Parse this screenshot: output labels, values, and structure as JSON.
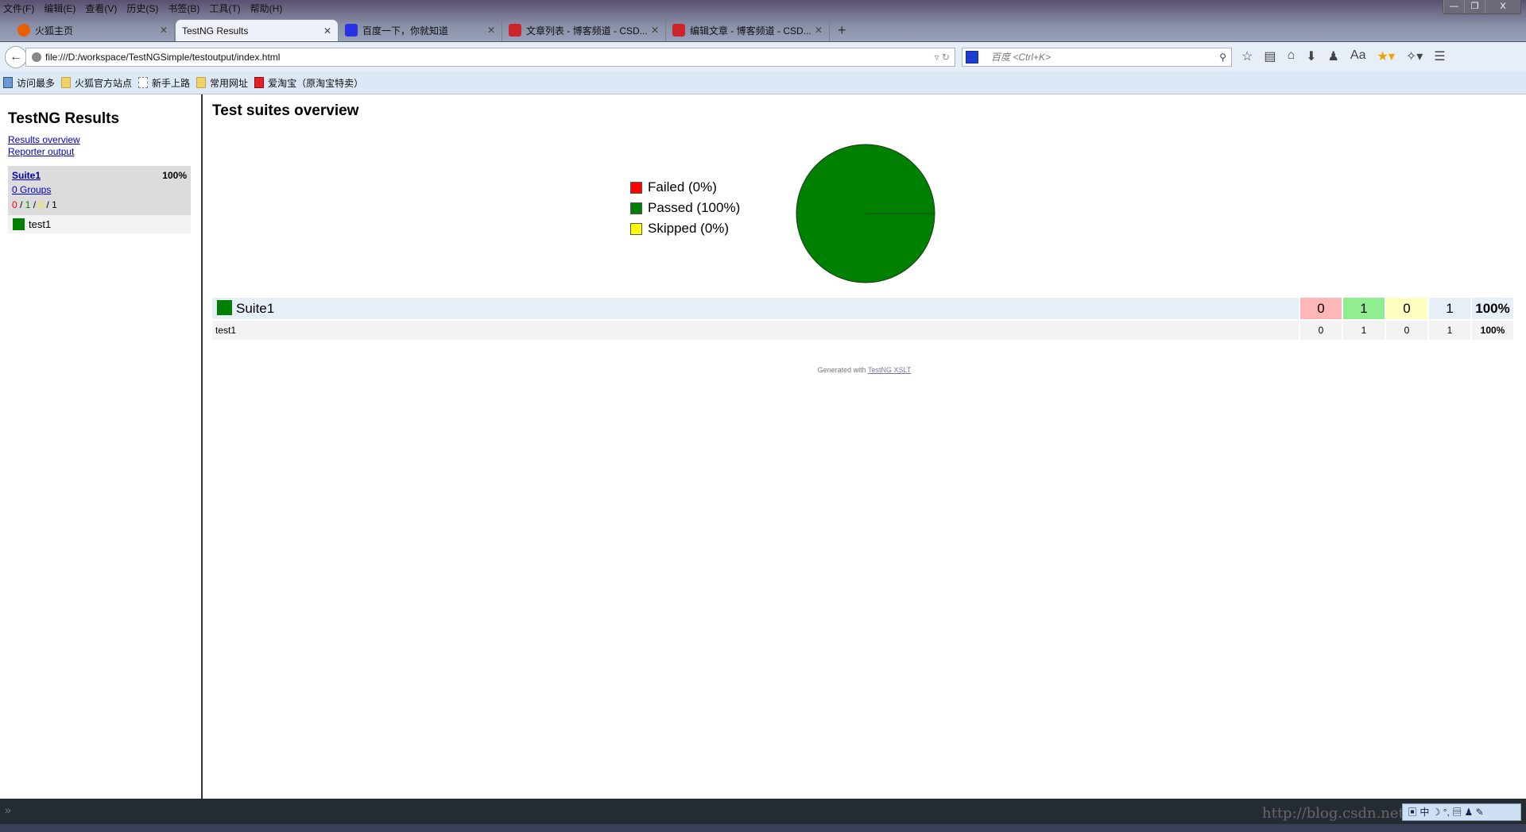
{
  "menubar": [
    "文件(F)",
    "编辑(E)",
    "查看(V)",
    "历史(S)",
    "书签(B)",
    "工具(T)",
    "帮助(H)"
  ],
  "window_buttons": [
    "—",
    "❐",
    "X"
  ],
  "tabs": [
    {
      "label": "火狐主页",
      "color": "#e66000"
    },
    {
      "label": "TestNG Results",
      "active": true
    },
    {
      "label": "百度一下，你就知道",
      "color": "#2932e1"
    },
    {
      "label": "文章列表 - 博客频道 - CSD...",
      "color": "#c9252b"
    },
    {
      "label": "编辑文章 - 博客频道 - CSD...",
      "color": "#c9252b"
    }
  ],
  "nav": {
    "url": "file:///D:/workspace/TestNGSimple/testoutput/index.html",
    "search_placeholder": "百度 <Ctrl+K>"
  },
  "bookmarks": [
    "访问最多",
    "火狐官方站点",
    "新手上路",
    "常用网址",
    "爱淘宝（原淘宝特卖）"
  ],
  "sidebar": {
    "title": "TestNG Results",
    "links": [
      "Results overview",
      "Reporter output"
    ],
    "suite": {
      "name": "Suite1",
      "percent": "100%",
      "groups": "0 Groups",
      "failed": "0",
      "passed": "1",
      "skipped": "0",
      "total": "1"
    },
    "tests": [
      "test1"
    ]
  },
  "main": {
    "title": "Test suites overview",
    "legend": [
      "Failed (0%)",
      "Passed (100%)",
      "Skipped (0%)"
    ],
    "rows": [
      {
        "name": "Suite1",
        "failed": "0",
        "passed": "1",
        "skipped": "0",
        "total": "1",
        "percent": "100%"
      },
      {
        "name": "test1",
        "failed": "0",
        "passed": "1",
        "skipped": "0",
        "total": "1",
        "percent": "100%"
      }
    ],
    "footer_text": "Generated with ",
    "footer_link": "TestNG XSLT"
  },
  "statusbar": {
    "watermark": "http://blog.csdn.net/..."
  },
  "chart_data": {
    "type": "pie",
    "categories": [
      "Failed",
      "Passed",
      "Skipped"
    ],
    "values": [
      0,
      100,
      0
    ],
    "colors": [
      "#ff0000",
      "#008000",
      "#ffff00"
    ],
    "legend": "left"
  }
}
